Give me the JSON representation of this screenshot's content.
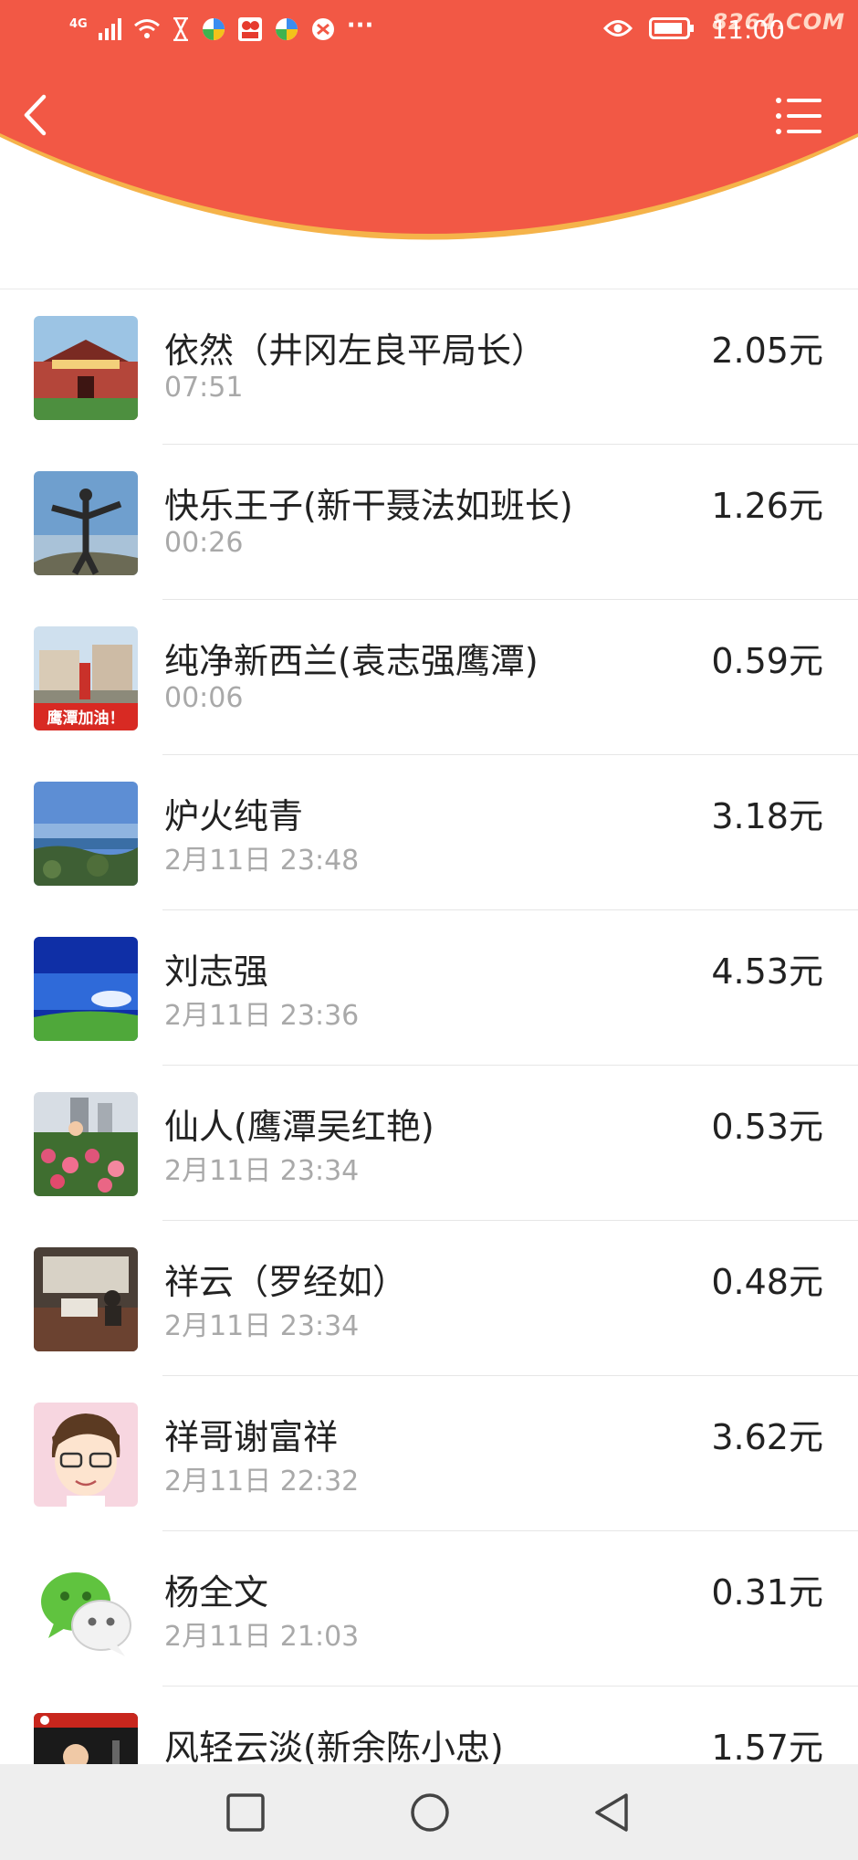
{
  "status": {
    "network": "4G",
    "time": "11:00",
    "watermark": "8264.COM",
    "more": "···"
  },
  "header": {
    "back_icon": "chevron-left-icon",
    "menu_icon": "list-menu-icon",
    "bg_color": "#f25845",
    "rim_color": "#f5b34a"
  },
  "records": [
    {
      "name": "依然（井冈左良平局长）",
      "time": "07:51",
      "amount": "2.05元",
      "avatar": "gate-photo"
    },
    {
      "name": "快乐王子(新干聂法如班长)",
      "time": "00:26",
      "amount": "1.26元",
      "avatar": "sky-jump-photo"
    },
    {
      "name": "纯净新西兰(袁志强鹰潭)",
      "time": "00:06",
      "amount": "0.59元",
      "avatar": "yingtan-photo",
      "avatar_text": "鹰潭加油！"
    },
    {
      "name": "炉火纯青",
      "time": "2月11日  23:48",
      "amount": "3.18元",
      "avatar": "coast-photo"
    },
    {
      "name": "刘志强",
      "time": "2月11日  23:36",
      "amount": "4.53元",
      "avatar": "blue-sky-photo"
    },
    {
      "name": "仙人(鹰潭吴红艳)",
      "time": "2月11日  23:34",
      "amount": "0.53元",
      "avatar": "flowers-photo"
    },
    {
      "name": "祥云（罗经如）",
      "time": "2月11日  23:34",
      "amount": "0.48元",
      "avatar": "office-photo"
    },
    {
      "name": "祥哥谢富祥",
      "time": "2月11日  22:32",
      "amount": "3.62元",
      "avatar": "cartoon-avatar"
    },
    {
      "name": "杨全文",
      "time": "2月11日  21:03",
      "amount": "0.31元",
      "avatar": "wechat-logo"
    },
    {
      "name": "风轻云淡(新余陈小忠)",
      "time": "",
      "amount": "1.57元",
      "avatar": "portrait-photo"
    }
  ],
  "navbar": {
    "recent_icon": "square-recent-icon",
    "home_icon": "circle-home-icon",
    "back_icon": "triangle-back-icon"
  }
}
